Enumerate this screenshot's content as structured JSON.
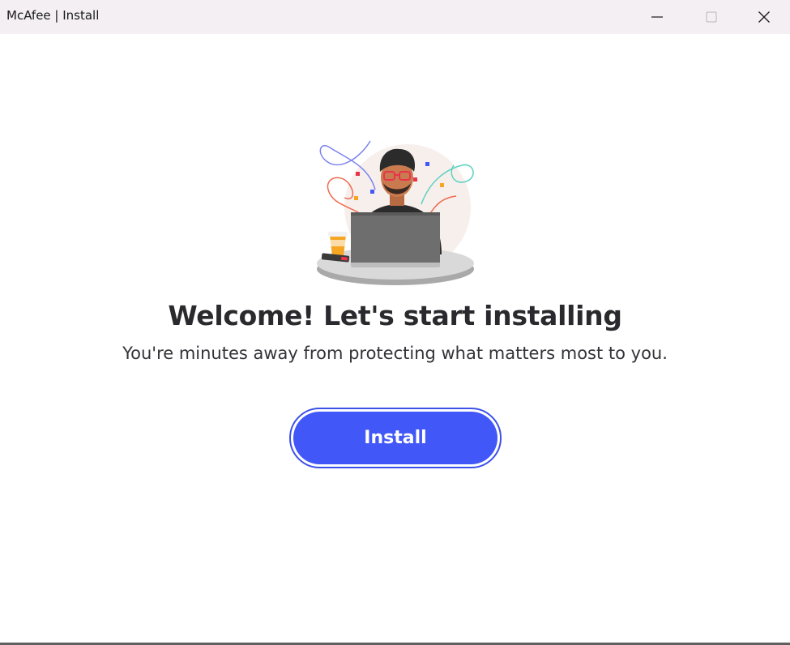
{
  "window": {
    "title": "McAfee | Install",
    "controls": {
      "minimize_icon": "minimize-icon",
      "maximize_icon": "maximize-icon",
      "close_icon": "close-icon"
    }
  },
  "main": {
    "illustration": "person-with-laptop-celebration-illustration",
    "headline": "Welcome! Let's start installing",
    "subheadline": "You're minutes away from protecting what matters most to you.",
    "install_button_label": "Install"
  },
  "colors": {
    "titlebar_bg": "#f3eff3",
    "accent": "#4257f7",
    "accent_border": "#3d50e8",
    "text_primary": "#2a2a2e"
  }
}
